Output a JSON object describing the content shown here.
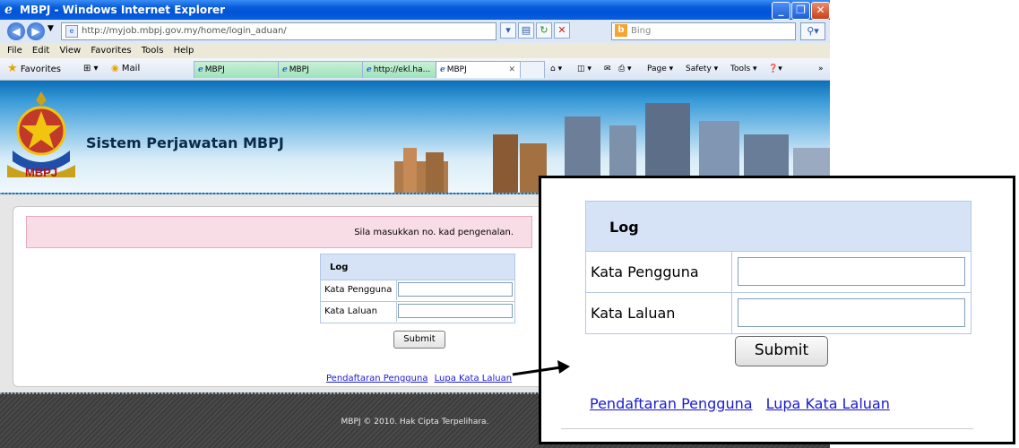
{
  "window": {
    "title": "MBPJ - Windows Internet Explorer",
    "url": "http://myjob.mbpj.gov.my/home/login_aduan/",
    "search_placeholder": "Bing"
  },
  "menu": [
    "File",
    "Edit",
    "View",
    "Favorites",
    "Tools",
    "Help"
  ],
  "favorites": {
    "label": "Favorites",
    "mail": "Mail"
  },
  "tabs": [
    {
      "label": "MBPJ",
      "active": false
    },
    {
      "label": "MBPJ",
      "active": false
    },
    {
      "label": "http://ekl.ha...",
      "active": false
    },
    {
      "label": "MBPJ",
      "active": true
    }
  ],
  "commands": {
    "page": "Page ▾",
    "safety": "Safety ▾",
    "tools": "Tools ▾"
  },
  "site": {
    "title": "Sistem Perjawatan MBPJ",
    "logo_text": "MBPJ"
  },
  "alert": "Sila masukkan no. kad pengenalan.",
  "login": {
    "header": "Log",
    "username_label": "Kata Pengguna",
    "password_label": "Kata Laluan",
    "submit": "Submit"
  },
  "links": {
    "register": "Pendaftaran Pengguna",
    "forgot": "Lupa Kata Laluan"
  },
  "footer": "MBPJ © 2010. Hak Cipta Terpelihara.",
  "colors": {
    "alert_bg": "#f9dde6",
    "login_header_bg": "#d6e3f6",
    "link": "#1a1ad0"
  }
}
